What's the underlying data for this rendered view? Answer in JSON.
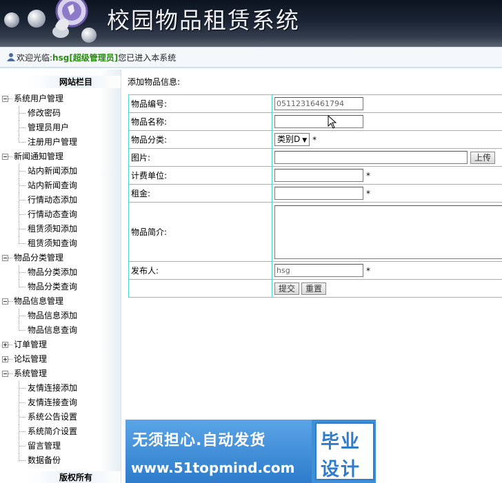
{
  "header": {
    "title": "校园物品租赁系统"
  },
  "welcome": {
    "prefix": "欢迎光临:",
    "user": "hsg[超级管理员]",
    "suffix": "您已进入本系统"
  },
  "sidebar": {
    "title": "网站栏目",
    "footer": "版权所有",
    "groups": [
      {
        "label": "系统用户管理",
        "expanded": true,
        "items": [
          "修改密码",
          "管理员用户",
          "注册用户管理"
        ]
      },
      {
        "label": "新闻通知管理",
        "expanded": true,
        "items": [
          "站内新闻添加",
          "站内新闻查询",
          "行情动态添加",
          "行情动态查询",
          "租赁须知添加",
          "租赁须知查询"
        ]
      },
      {
        "label": "物品分类管理",
        "expanded": true,
        "items": [
          "物品分类添加",
          "物品分类查询"
        ]
      },
      {
        "label": "物品信息管理",
        "expanded": true,
        "items": [
          "物品信息添加",
          "物品信息查询"
        ]
      },
      {
        "label": "订单管理",
        "expanded": false,
        "items": []
      },
      {
        "label": "论坛管理",
        "expanded": false,
        "items": []
      },
      {
        "label": "系统管理",
        "expanded": true,
        "items": [
          "友情连接添加",
          "友情连接查询",
          "系统公告设置",
          "系统简介设置",
          "留言管理",
          "数据备份"
        ]
      }
    ]
  },
  "form": {
    "caption": "添加物品信息:",
    "required_mark": "*",
    "fields": {
      "code": {
        "label": "物品编号:",
        "value": "05112316461794"
      },
      "name": {
        "label": "物品名称:",
        "value": ""
      },
      "category": {
        "label": "物品分类:",
        "selected": "类别D",
        "arrow": "▼"
      },
      "image": {
        "label": "图片:",
        "value": "",
        "upload": "上传"
      },
      "unit": {
        "label": "计费单位:",
        "value": ""
      },
      "rent": {
        "label": "租金:",
        "value": ""
      },
      "intro": {
        "label": "物品简介:",
        "value": ""
      },
      "publisher": {
        "label": "发布人:",
        "value": "hsg"
      }
    },
    "submit": "提交",
    "reset": "重置"
  },
  "promo": {
    "line1": "无须担心.自动发货",
    "line2": "www.51topmind.com",
    "right1": "毕业",
    "right2": "设计"
  }
}
